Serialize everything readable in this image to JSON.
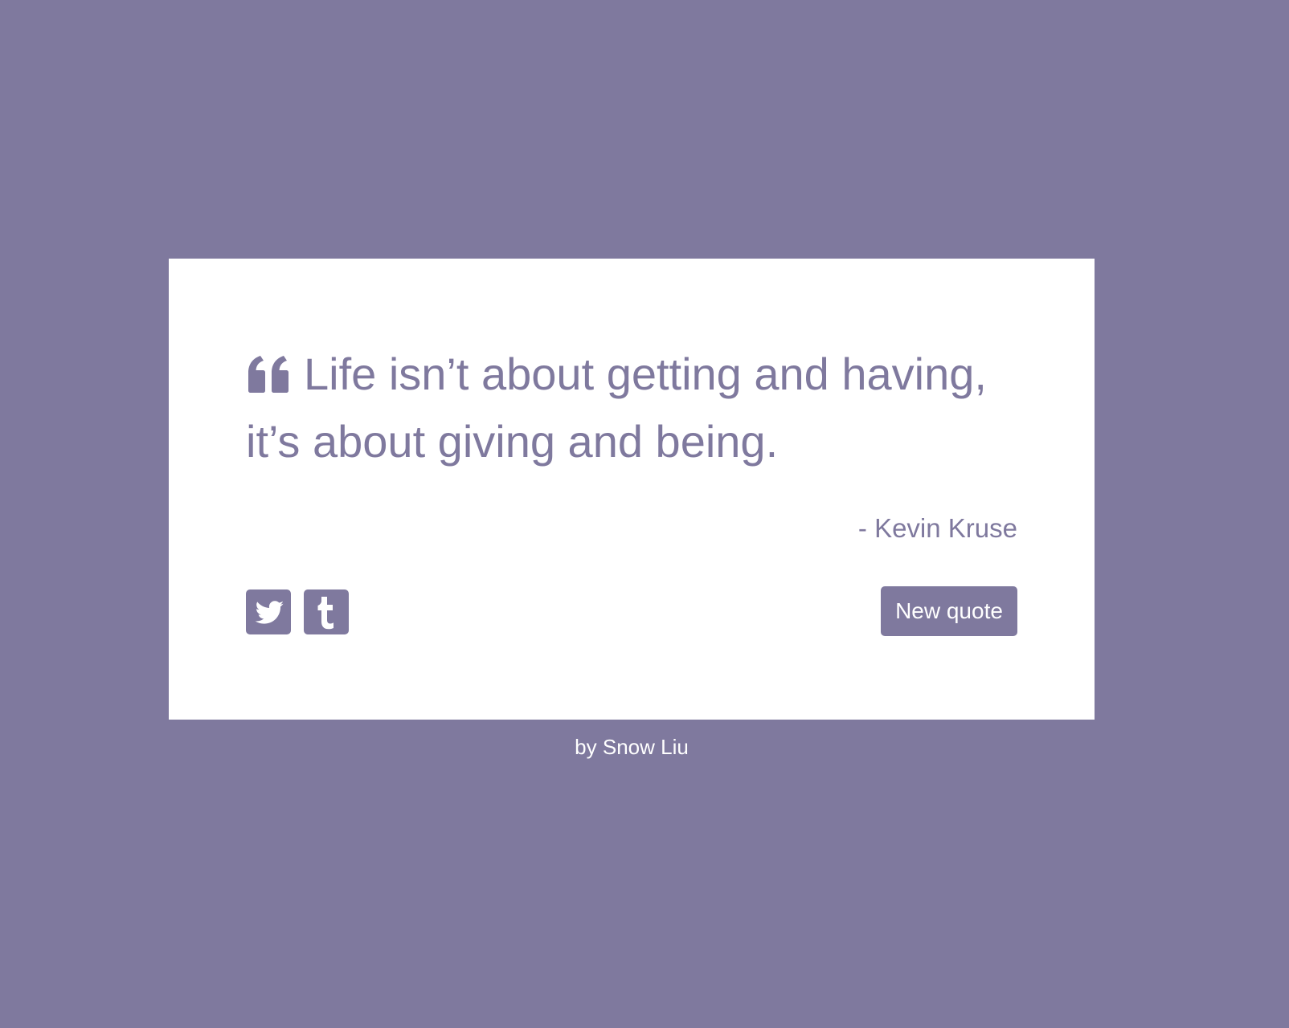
{
  "quote": {
    "icon": "quote-left-icon",
    "text": "Life isn’t about getting and having, it’s about giving and being.",
    "author": "- Kevin Kruse"
  },
  "share": {
    "twitter_icon": "twitter-icon",
    "tumblr_icon": "tumblr-icon"
  },
  "actions": {
    "new_quote_label": "New quote"
  },
  "footer": {
    "credit": "by Snow Liu"
  },
  "colors": {
    "background": "#7f799e",
    "card": "#ffffff",
    "accent": "#7f799e",
    "button_text": "#ffffff"
  }
}
